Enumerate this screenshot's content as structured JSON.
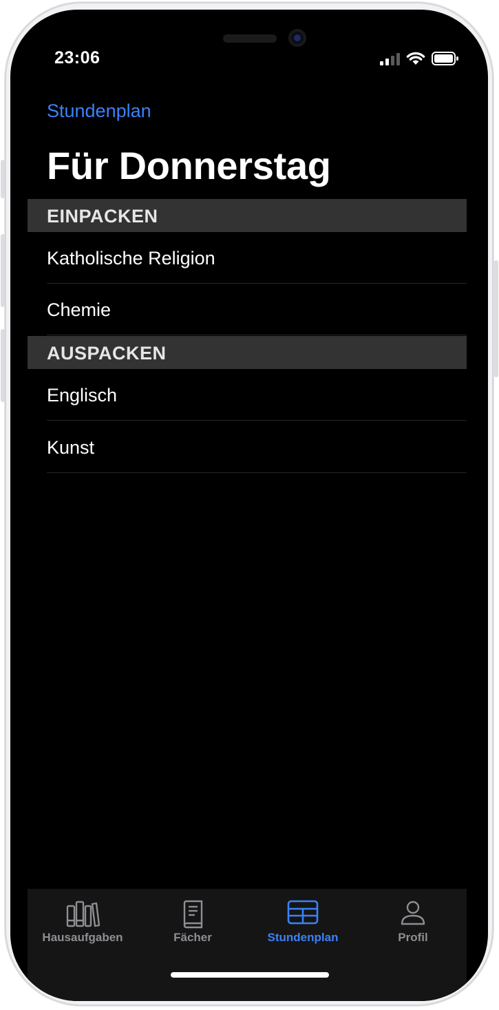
{
  "status": {
    "time": "23:06"
  },
  "nav": {
    "back_label": "Stundenplan",
    "title": "Für Donnerstag"
  },
  "sections": [
    {
      "header": "EINPACKEN",
      "items": [
        "Katholische Religion",
        "Chemie"
      ]
    },
    {
      "header": "AUSPACKEN",
      "items": [
        "Englisch",
        "Kunst"
      ]
    }
  ],
  "tabbar": {
    "tabs": [
      {
        "label": "Hausaufgaben",
        "icon": "books-icon",
        "active": false
      },
      {
        "label": "Fächer",
        "icon": "book-icon",
        "active": false
      },
      {
        "label": "Stundenplan",
        "icon": "table-icon",
        "active": true
      },
      {
        "label": "Profil",
        "icon": "person-icon",
        "active": false
      }
    ]
  },
  "colors": {
    "accent": "#3b82f6",
    "background": "#000000",
    "section_header": "#333334",
    "tabbar": "#151516"
  }
}
